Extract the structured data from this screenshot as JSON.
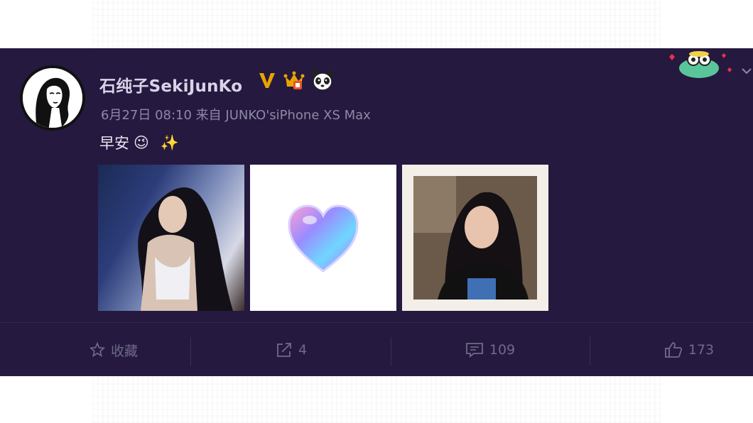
{
  "post": {
    "author_name": "石纯子SekiJunKo",
    "meta": "6月27日 08:10 来自 JUNKO'siPhone XS Max",
    "text": "早安",
    "emoji_wink": "😉",
    "emoji_sparkles": "✨"
  },
  "badges": {
    "verified_v": "V"
  },
  "photos": [
    {
      "name": "photo-woman-portrait"
    },
    {
      "name": "photo-heart"
    },
    {
      "name": "photo-woman-selfie"
    }
  ],
  "actions": {
    "favorite_label": "收藏",
    "repost_count": "4",
    "comment_count": "109",
    "like_count": "173"
  },
  "colors": {
    "card_bg": "#25193f",
    "badge_gold": "#e8a400",
    "muted_text": "#6f6a88"
  },
  "icons": [
    "star-icon",
    "repost-icon",
    "comment-icon",
    "thumbs-up-icon",
    "panda-icon",
    "crown-icon",
    "verified-v-icon",
    "chevron-down-icon"
  ]
}
